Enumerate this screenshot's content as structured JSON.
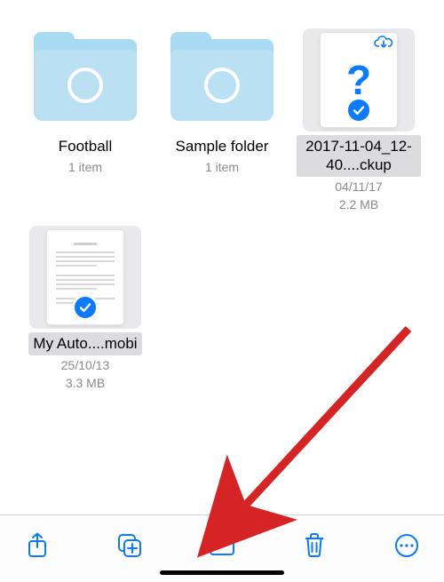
{
  "grid": {
    "items": [
      {
        "kind": "folder",
        "name": "Football",
        "sub1": "1 item",
        "sub2": "",
        "selected": false
      },
      {
        "kind": "folder",
        "name": "Sample folder",
        "sub1": "1 item",
        "sub2": "",
        "selected": false
      },
      {
        "kind": "unknown-file",
        "name": "2017-11-04_12-40....ckup",
        "sub1": "04/11/17",
        "sub2": "2.2 MB",
        "selected": true,
        "cloud": true
      },
      {
        "kind": "document",
        "name": "My Auto....mobi",
        "sub1": "25/10/13",
        "sub2": "3.3 MB",
        "selected": true
      }
    ]
  },
  "toolbar": {
    "share_icon": "share-icon",
    "duplicate_icon": "duplicate-icon",
    "move_icon": "folder-icon",
    "delete_icon": "trash-icon",
    "more_icon": "more-icon"
  },
  "annotation": {
    "arrow_color": "#d62323",
    "target": "move-button"
  }
}
